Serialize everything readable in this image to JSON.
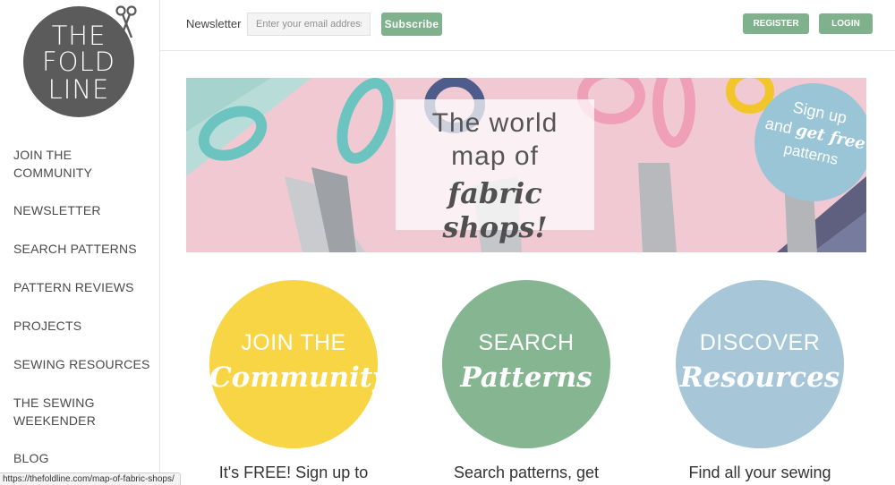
{
  "logo": {
    "line1": "THE",
    "line2": "FOLD",
    "line3": "LINE"
  },
  "sidebar": {
    "items": [
      {
        "label": "JOIN THE",
        "label2": "COMMUNITY"
      },
      {
        "label": "NEWSLETTER",
        "label2": ""
      },
      {
        "label": "SEARCH PATTERNS",
        "label2": ""
      },
      {
        "label": "PATTERN REVIEWS",
        "label2": ""
      },
      {
        "label": "PROJECTS",
        "label2": ""
      },
      {
        "label": "SEWING RESOURCES",
        "label2": ""
      },
      {
        "label": "THE SEWING",
        "label2": "WEEKENDER"
      },
      {
        "label": "BLOG",
        "label2": ""
      }
    ]
  },
  "topbar": {
    "newsletter_label": "Newsletter",
    "email_placeholder": "Enter your email address",
    "subscribe_label": "Subscribe",
    "register_label": "REGISTER",
    "login_label": "LOGIN"
  },
  "banner": {
    "line1": "The world",
    "line2": "map of",
    "line3": "fabric shops!",
    "badge_line1": "Sign up",
    "badge_line2_a": "and ",
    "badge_line2_b": "get free",
    "badge_line3": "patterns"
  },
  "features": [
    {
      "top": "JOIN THE",
      "bottom": "Community",
      "caption": "It's FREE! Sign up to",
      "color": "#f8d544"
    },
    {
      "top": "SEARCH",
      "bottom": "Patterns",
      "caption": "Search patterns, get",
      "color": "#85b591"
    },
    {
      "top": "DISCOVER",
      "bottom": "Resources",
      "caption": "Find all your sewing",
      "color": "#a7c7d9"
    }
  ],
  "statusbar": {
    "url": "https://thefoldline.com/map-of-fabric-shops/"
  },
  "colors": {
    "accent_green": "#7fb18c",
    "logo_gray": "#5b5b5b"
  }
}
